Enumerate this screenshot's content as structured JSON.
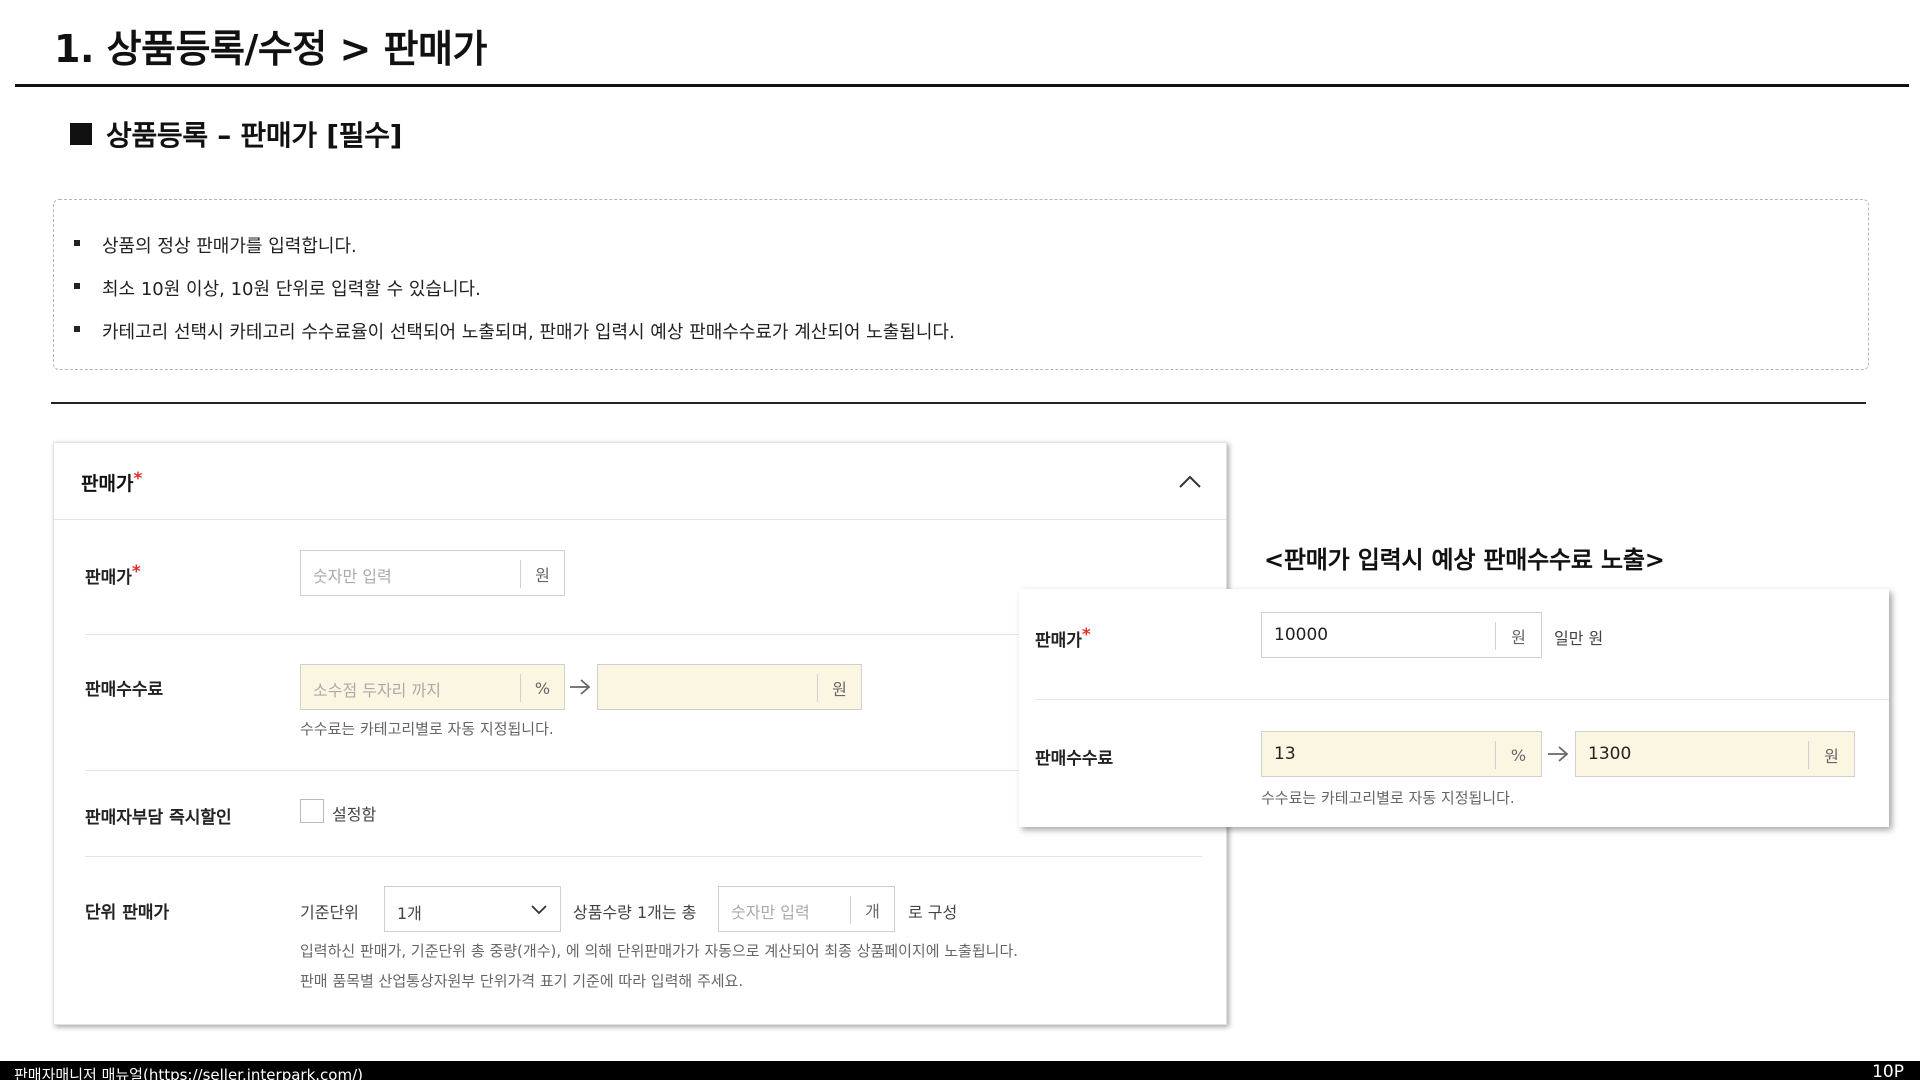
{
  "page": {
    "title": "1. 상품등록/수정 > 판매가",
    "section_heading": "상품등록 – 판매가 [필수]"
  },
  "info": {
    "items": [
      "상품의 정상 판매가를 입력합니다.",
      "최소 10원 이상, 10원 단위로 입력할 수 있습니다.",
      "카테고리 선택시 카테고리 수수료율이 선택되어 노출되며, 판매가 입력시 예상 판매수수료가 계산되어 노출됩니다."
    ]
  },
  "form": {
    "panel_title": "판매가",
    "required_mark": "*",
    "price": {
      "label": "판매가",
      "placeholder": "숫자만 입력",
      "unit": "원"
    },
    "commission": {
      "label": "판매수수료",
      "rate_placeholder": "소수점 두자리 까지",
      "rate_unit": "%",
      "amount_unit": "원",
      "hint": "수수료는 카테고리별로 자동 지정됩니다."
    },
    "discount": {
      "label": "판매자부담 즉시할인",
      "checkbox_label": "설정함"
    },
    "unit_price": {
      "label": "단위 판매가",
      "base_unit_label": "기준단위",
      "base_unit_value": "1개",
      "qty_prefix": "상품수량 1개는 총",
      "qty_placeholder": "숫자만 입력",
      "qty_unit": "개",
      "qty_suffix": "로 구성",
      "hint_1": "입력하신 판매가, 기준단위 총 중량(개수), 에 의해 단위판매가가 자동으로 계산되어 최종 상품페이지에 노출됩니다.",
      "hint_2": "판매 품목별 산업통상자원부 단위가격 표기 기준에 따라 입력해 주세요."
    }
  },
  "preview": {
    "caption": "<판매가 입력시 예상 판매수수료 노출>",
    "price_label": "판매가",
    "price_value": "10000",
    "price_unit": "원",
    "price_readable": "일만 원",
    "commission_label": "판매수수료",
    "rate_value": "13",
    "rate_unit": "%",
    "amount_value": "1300",
    "amount_unit": "원",
    "hint": "수수료는 카테고리별로 자동 지정됩니다."
  },
  "footer": {
    "left": "판매자매니저 매뉴얼(https://seller.interpark.com/)",
    "page_number": "10P"
  }
}
